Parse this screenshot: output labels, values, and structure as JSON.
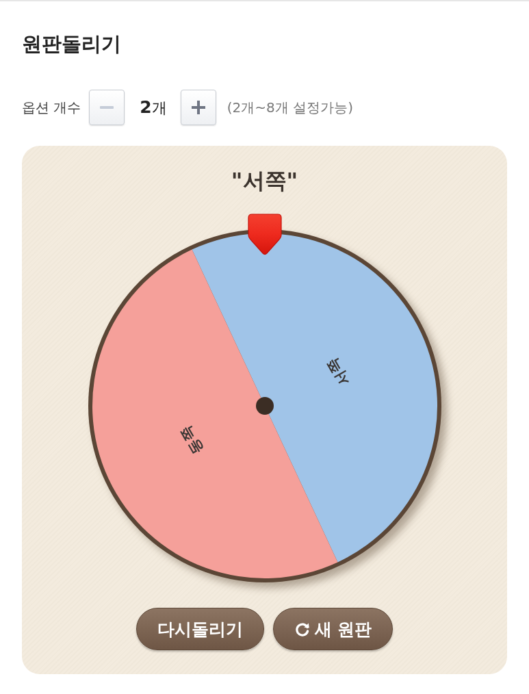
{
  "page": {
    "title": "원판돌리기"
  },
  "options": {
    "label": "옵션 개수",
    "decrement": {
      "disabled": true
    },
    "value": "**2**개",
    "increment": {
      "disabled": false
    },
    "hint": "(2개~8개 설정가능)"
  },
  "wheel": {
    "result": "\"서쪽\"",
    "segments": [
      {
        "label": "서쪽",
        "color": "#a0c4e8"
      },
      {
        "label": "동쪽",
        "color": "#f5a09a"
      }
    ]
  },
  "buttons": [
    {
      "label": "다시돌리기",
      "kind": "plain"
    },
    {
      "label": "새 원판",
      "kind": "refresh"
    }
  ]
}
